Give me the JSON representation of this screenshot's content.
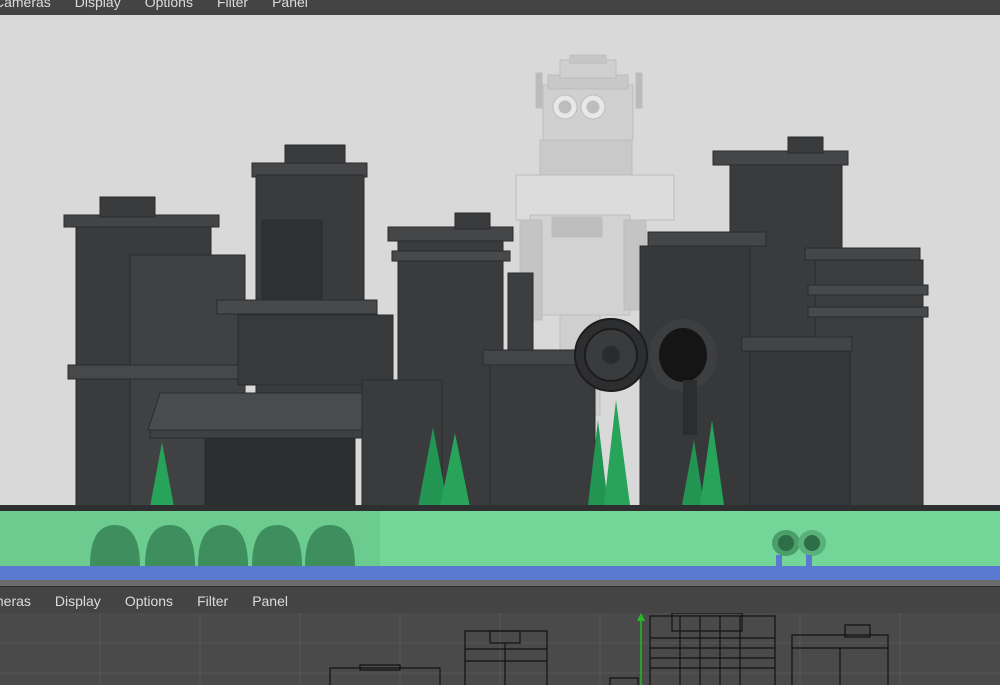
{
  "viewport_top": {
    "menu": [
      {
        "label": "Cameras"
      },
      {
        "label": "Display"
      },
      {
        "label": "Options"
      },
      {
        "label": "Filter"
      },
      {
        "label": "Panel"
      }
    ]
  },
  "viewport_bottom": {
    "menu": [
      {
        "label": "meras"
      },
      {
        "label": "Display"
      },
      {
        "label": "Options"
      },
      {
        "label": "Filter"
      },
      {
        "label": "Panel"
      }
    ]
  },
  "colors": {
    "menubar": "#444444",
    "viewport_background": "#d9d9d9",
    "buildings": "#3a3b3d",
    "robot": "#d6d6d6",
    "ground": "#6ccc8f",
    "trees": "#27a35a",
    "water_strip": "#5a79d0",
    "wireframe_background": "#4a4a4a",
    "wireframe_lines": "#111111",
    "axis_y": "#22bb22"
  }
}
